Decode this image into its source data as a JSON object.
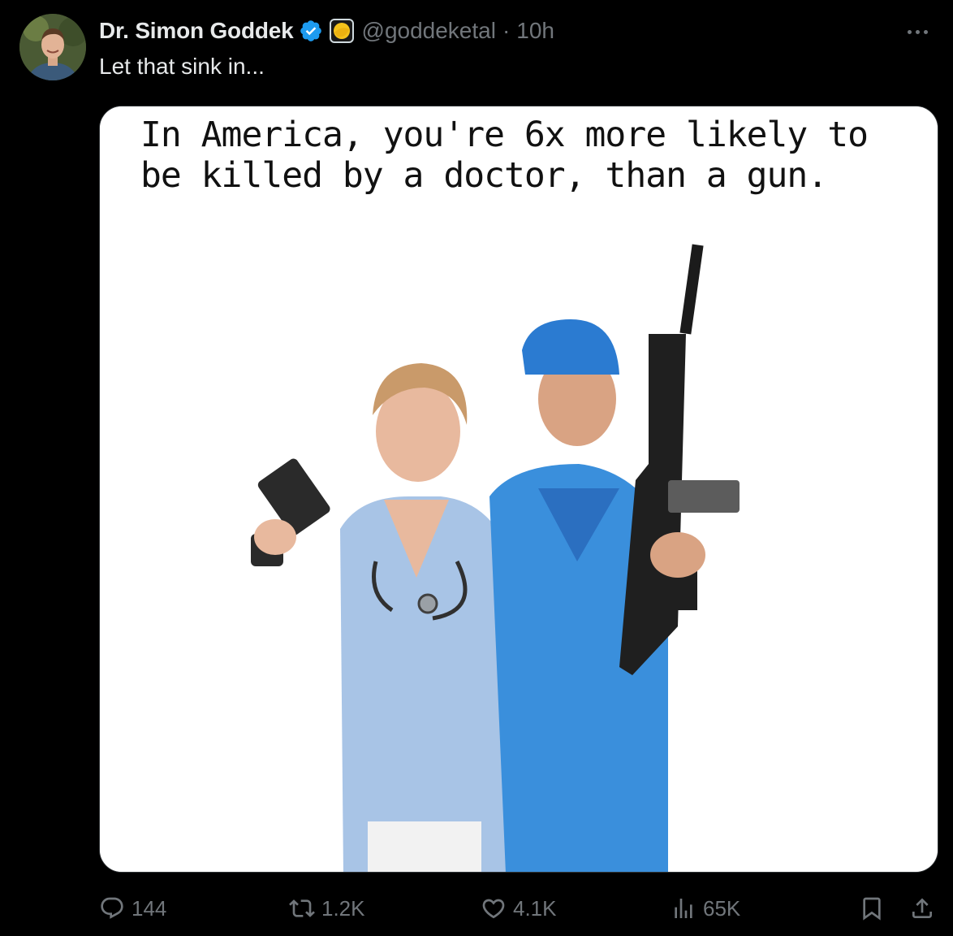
{
  "tweet": {
    "display_name": "Dr. Simon Goddek",
    "handle": "@goddeketal",
    "separator": "·",
    "time": "10h",
    "text": "Let that sink in...",
    "more_icon": "more-horizontal-icon",
    "verified_color": "#1d9bf0",
    "media": {
      "caption": "In America, you're 6x more likely to\nbe killed by a doctor, than a gun."
    },
    "actions": {
      "replies": "144",
      "reposts": "1.2K",
      "likes": "4.1K",
      "views": "65K"
    }
  }
}
